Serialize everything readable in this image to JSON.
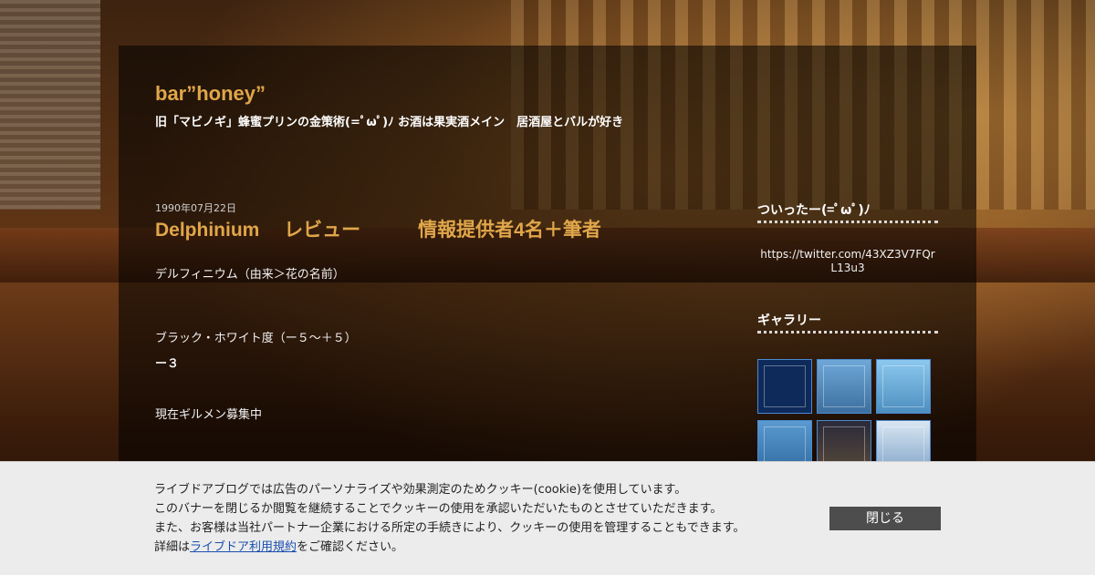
{
  "blog": {
    "title": "bar”honey”",
    "subtitle": "旧「マビノギ」蜂蜜プリンの金策術(=ﾟωﾟ)ﾉ お酒は果実酒メイン　居酒屋とバルが好き"
  },
  "post": {
    "date": "1990年07月22日",
    "title": "Delphinium　 レビュー　　　情報提供者4名＋筆者",
    "lines": [
      "デルフィニウム（由来＞花の名前）",
      "ブラック・ホワイト度（ー５～＋５）",
      "ー３",
      "現在ギルメン募集中"
    ]
  },
  "sidebar": {
    "twitter_heading": "ついったー(=ﾟωﾟ)ﾉ",
    "twitter_link": "https://twitter.com/43XZ3V7FQrL13u3",
    "gallery_heading": "ギャラリー",
    "gallery_count": 6
  },
  "cookie_banner": {
    "line1": "ライブドアブログでは広告のパーソナライズや効果測定のためクッキー(cookie)を使用しています。",
    "line2": "このバナーを閉じるか閲覧を継続することでクッキーの使用を承認いただいたものとさせていただきます。",
    "line3": "また、お客様は当社パートナー企業における所定の手続きにより、クッキーの使用を管理することもできます。",
    "line4_prefix": "詳細は",
    "line4_link": "ライブドア利用規約",
    "line4_suffix": "をご確認ください。",
    "close_label": "閉じる"
  },
  "colors": {
    "accent": "#e0a64a",
    "link": "#1a4fb0",
    "button": "#4d4d4d"
  }
}
